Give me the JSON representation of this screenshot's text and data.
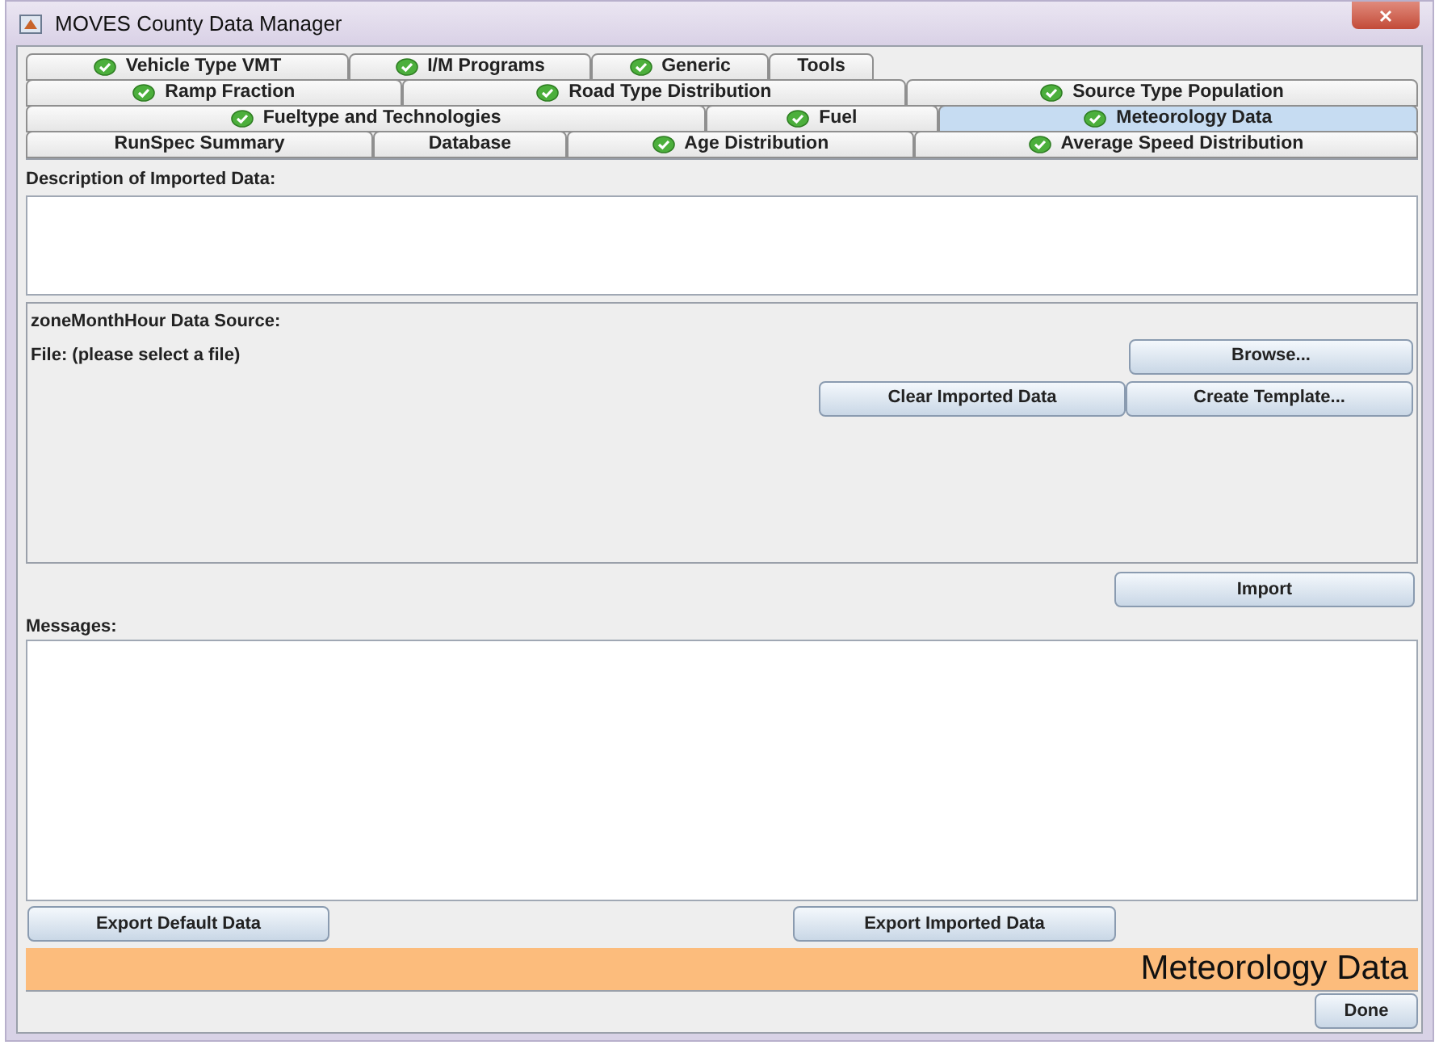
{
  "window": {
    "title": "MOVES County Data Manager"
  },
  "tab_rows": [
    [
      {
        "label": "Vehicle Type VMT",
        "check": true,
        "selected": false
      },
      {
        "label": "I/M Programs",
        "check": true,
        "selected": false
      },
      {
        "label": "Generic",
        "check": true,
        "selected": false
      },
      {
        "label": "Tools",
        "check": false,
        "selected": false
      }
    ],
    [
      {
        "label": "Ramp Fraction",
        "check": true,
        "selected": false
      },
      {
        "label": "Road Type Distribution",
        "check": true,
        "selected": false
      },
      {
        "label": "Source Type Population",
        "check": true,
        "selected": false
      }
    ],
    [
      {
        "label": "Fueltype and Technologies",
        "check": true,
        "selected": false
      },
      {
        "label": "Fuel",
        "check": true,
        "selected": false
      },
      {
        "label": "Meteorology Data",
        "check": true,
        "selected": true
      }
    ],
    [
      {
        "label": "RunSpec Summary",
        "check": false,
        "selected": false
      },
      {
        "label": "Database",
        "check": false,
        "selected": false
      },
      {
        "label": "Age Distribution",
        "check": true,
        "selected": false
      },
      {
        "label": "Average Speed Distribution",
        "check": true,
        "selected": false
      }
    ]
  ],
  "description_label": "Description of Imported Data:",
  "source": {
    "title": "zoneMonthHour Data Source:",
    "file_label": "File: (please select a file)",
    "browse": "Browse...",
    "clear": "Clear Imported Data",
    "template": "Create Template..."
  },
  "import_button": "Import",
  "messages_label": "Messages:",
  "export_default": "Export Default Data",
  "export_imported": "Export Imported Data",
  "banner": "Meteorology Data",
  "done": "Done"
}
